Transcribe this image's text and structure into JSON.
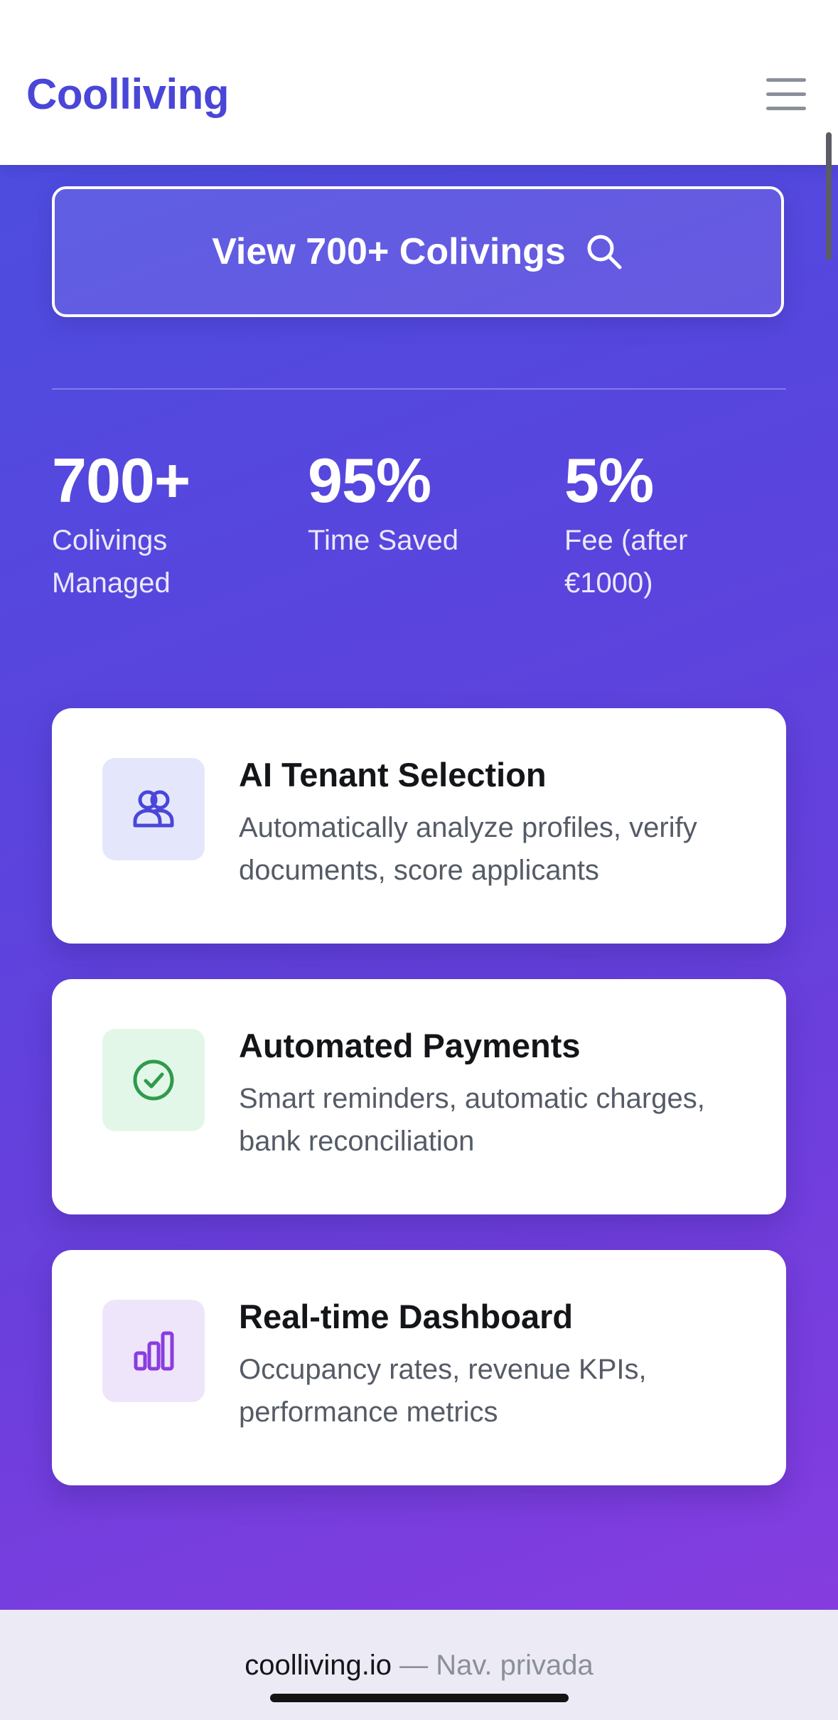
{
  "header": {
    "brand": "Coolliving",
    "menu_icon": "hamburger-menu-icon"
  },
  "cta": {
    "label": "View 700+ Colivings",
    "icon": "search-icon"
  },
  "stats": [
    {
      "value": "700+",
      "label": "Colivings Managed"
    },
    {
      "value": "95%",
      "label": "Time Saved"
    },
    {
      "value": "5%",
      "label": "Fee (after €1000)"
    }
  ],
  "features": [
    {
      "title": "AI Tenant Selection",
      "description": "Automatically analyze profiles, verify documents, score applicants",
      "icon": "users-icon",
      "icon_bg": "#e4e7fb",
      "icon_color": "#4a46d8"
    },
    {
      "title": "Automated Payments",
      "description": "Smart reminders, automatic charges, bank reconciliation",
      "icon": "check-circle-icon",
      "icon_bg": "#e3f7e9",
      "icon_color": "#2f9a4c"
    },
    {
      "title": "Real-time Dashboard",
      "description": "Occupancy rates, revenue KPIs, performance metrics",
      "icon": "bar-chart-icon",
      "icon_bg": "#efe5fa",
      "icon_color": "#8a3ce0"
    }
  ],
  "browser_bar": {
    "domain": "coolliving.io",
    "mode": " — Nav. privada"
  },
  "colors": {
    "brand": "#4a46d8",
    "gradient_start": "#4a4fe0",
    "gradient_end": "#8a3ce0"
  }
}
